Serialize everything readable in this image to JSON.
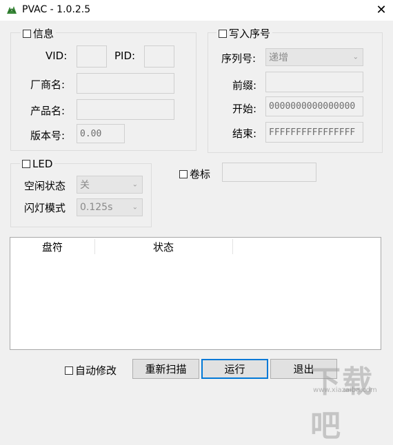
{
  "window": {
    "title": "PVAC - 1.0.2.5",
    "close_glyph": "✕"
  },
  "info_group": {
    "label": "信息",
    "vid_label": "VID:",
    "pid_label": "PID:",
    "vid_value": "",
    "pid_value": "",
    "vendor_label": "厂商名:",
    "vendor_value": "",
    "product_label": "产品名:",
    "product_value": "",
    "version_label": "版本号:",
    "version_value": "0.00"
  },
  "serial_group": {
    "label": "写入序号",
    "serial_label": "序列号:",
    "serial_mode": "递增",
    "prefix_label": "前缀:",
    "prefix_value": "",
    "start_label": "开始:",
    "start_value": "0000000000000000",
    "end_label": "结束:",
    "end_value": "FFFFFFFFFFFFFFFF"
  },
  "led_group": {
    "label": "LED",
    "idle_label": "空闲状态",
    "idle_value": "关",
    "blink_label": "闪灯模式",
    "blink_value": "0.125s"
  },
  "volume": {
    "label": "卷标",
    "value": ""
  },
  "list": {
    "columns": [
      "盘符",
      "状态"
    ]
  },
  "footer": {
    "auto_modify_label": "自动修改",
    "rescan_label": "重新扫描",
    "run_label": "运行",
    "exit_label": "退出"
  },
  "watermark": {
    "text": "下载吧",
    "sub": "www.xiazaiba.com"
  }
}
